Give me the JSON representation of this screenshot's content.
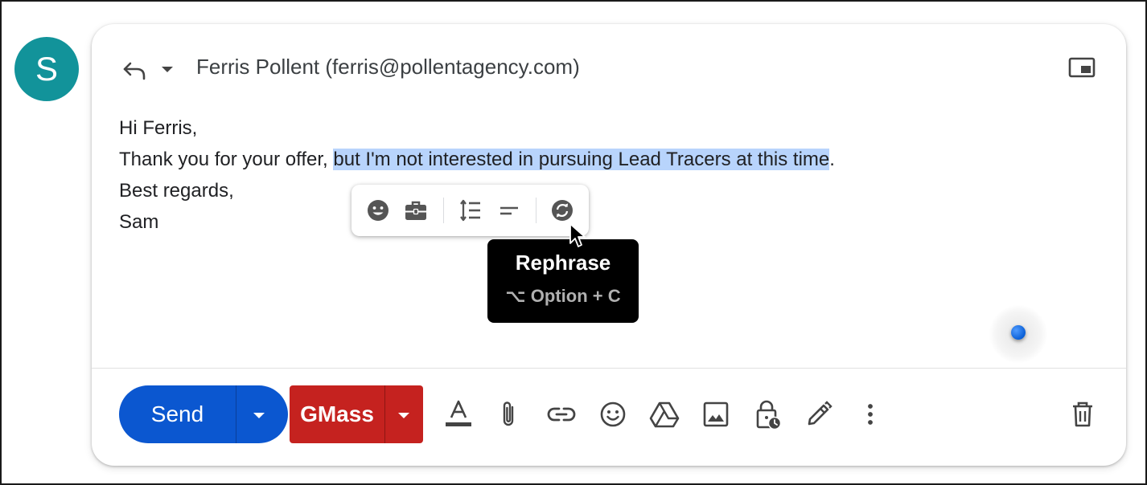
{
  "avatar": {
    "initial": "S",
    "color": "#12939a"
  },
  "header": {
    "recipient": "Ferris Pollent (ferris@pollentagency.com)",
    "icons": [
      "reply-icon",
      "chevron-down-icon",
      "popout-icon"
    ]
  },
  "body": {
    "greeting": "Hi Ferris,",
    "line2_before": "Thank you for your offer, ",
    "line2_selected": "but I'm not interested in pursuing Lead Tracers at this time",
    "line2_after": ".",
    "closing": "Best regards,",
    "signature": "Sam",
    "selection_color": "#b8d4fc"
  },
  "floating_toolbar": {
    "icons": [
      "emoji-icon",
      "briefcase-icon",
      "line-spacing-icon",
      "shorten-icon",
      "rephrase-icon"
    ]
  },
  "tooltip": {
    "title": "Rephrase",
    "shortcut": "⌥ Option + C"
  },
  "bottom_toolbar": {
    "send_label": "Send",
    "send_color": "#0b57d0",
    "gmass_label": "GMass",
    "gmass_color": "#c5221f",
    "icons": [
      "text-format-icon",
      "attach-icon",
      "link-icon",
      "emoji-icon",
      "drive-icon",
      "image-icon",
      "confidential-mode-icon",
      "signature-icon",
      "more-options-icon",
      "delete-icon"
    ]
  }
}
